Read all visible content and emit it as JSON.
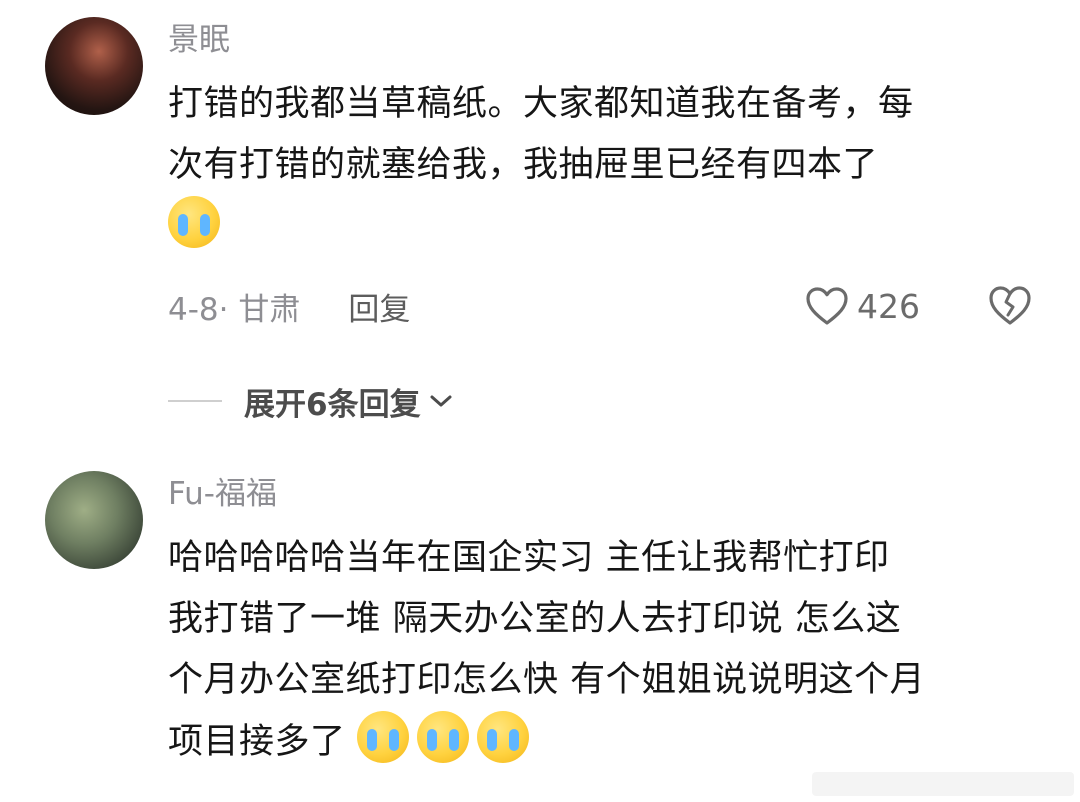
{
  "comments": [
    {
      "username": "景眠",
      "lines": [
        "打错的我都当草稿纸。大家都知道我在备考，每",
        "次有打错的就塞给我，我抽屉里已经有四本了"
      ],
      "emojis": [
        "loudly-crying-face"
      ],
      "date_location": "4-8· 甘肃",
      "reply_label": "回复",
      "like_count": "426",
      "expand_label": "展开6条回复"
    },
    {
      "username": "Fu-福福",
      "lines": [
        "哈哈哈哈哈当年在国企实习 主任让我帮忙打印",
        "我打错了一堆 隔天办公室的人去打印说 怎么这",
        "个月办公室纸打印怎么快 有个姐姐说说明这个月",
        "项目接多了"
      ],
      "emojis": [
        "holding-back-tears-face",
        "holding-back-tears-face",
        "holding-back-tears-face"
      ]
    }
  ],
  "colors": {
    "username": "#8e8e93",
    "text": "#161616",
    "meta": "#8e8e93",
    "emoji": "#ffd23f"
  }
}
